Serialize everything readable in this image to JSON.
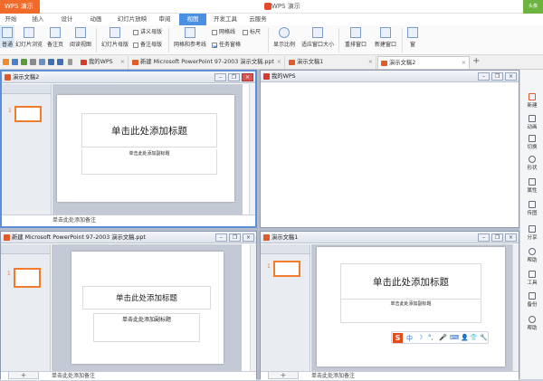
{
  "app": {
    "button": "WPS 演示",
    "title": "WPS 演示",
    "user": "头像"
  },
  "menu": {
    "items": [
      "开始",
      "插入",
      "设计",
      "动画",
      "幻灯片放映",
      "审阅",
      "视图",
      "开发工具",
      "云服务"
    ],
    "active": "视图"
  },
  "ribbon": {
    "normal": "普通",
    "outline": "幻灯片浏览",
    "notes_page": "备注页",
    "reading": "阅读视图",
    "slide_master": "幻灯片母版",
    "handout_master": "讲义母版",
    "notes_master": "备注母版",
    "grid_guides": "网格和参考线",
    "gridlines": "网格线",
    "ruler": "标尺",
    "taskpane": "任务窗格",
    "zoom": "显示比例",
    "fit": "适应窗口大小",
    "rearrange": "重排窗口",
    "new_window": "新建窗口",
    "switch": "窗"
  },
  "tabs": [
    {
      "label": "我的WPS",
      "color": "#d9392b"
    },
    {
      "label": "新建 Microsoft PowerPoint 97-2003 演示文稿.ppt",
      "color": "#e05a2a"
    },
    {
      "label": "演示文稿1",
      "color": "#e05a2a"
    },
    {
      "label": "演示文稿2",
      "color": "#e05a2a"
    }
  ],
  "panes": {
    "top_left": {
      "title": "演示文稿2",
      "slide_num": "1",
      "title_ph": "单击此处添加标题",
      "sub_ph": "单击此处添加副标题",
      "notes": "单击此处添加备注"
    },
    "top_right": {
      "title": "我的WPS"
    },
    "bottom_left": {
      "title": "新建 Microsoft PowerPoint 97-2003 演示文稿.ppt",
      "slide_num": "1",
      "title_ph": "单击此处添加标题",
      "sub_ph": "单击此处添加副标题",
      "notes": "单击此处添加备注"
    },
    "bottom_right": {
      "title": "演示文稿1",
      "slide_num": "1",
      "title_ph": "单击此处添加标题",
      "sub_ph": "单击此处添加副标题",
      "notes": "单击此处添加备注"
    }
  },
  "add_slide": "+",
  "sidebar": [
    "新建",
    "动画",
    "切换",
    "形状",
    "属性",
    "传图",
    "分享",
    "帮助",
    "工具",
    "备份",
    "帮助"
  ],
  "ime": {
    "logo": "S",
    "glyphs": [
      "中",
      "☽",
      "°,",
      "🎤",
      "⌨",
      "👤",
      "👕",
      "🔧"
    ]
  },
  "colors": {
    "accent": "#4a90e2",
    "orange": "#f07c2c",
    "wps_red": "#d9392b"
  }
}
